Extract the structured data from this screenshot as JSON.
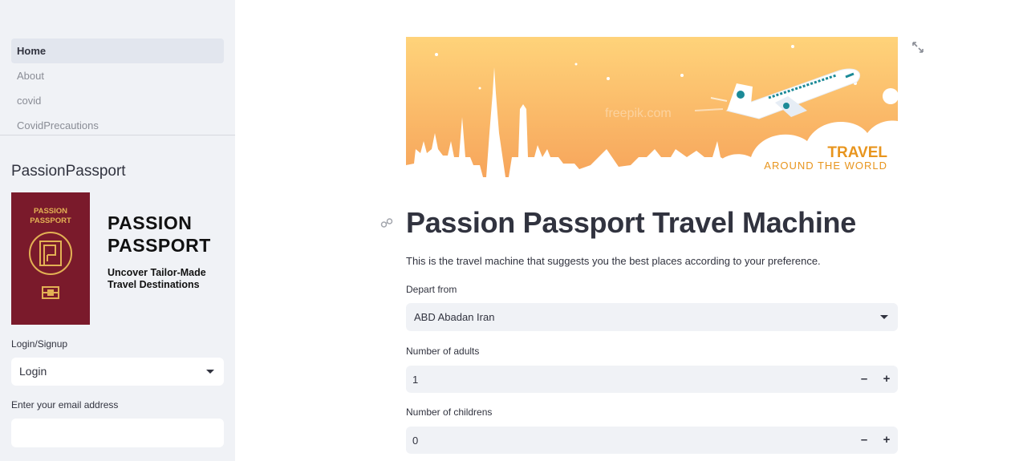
{
  "sidebar": {
    "nav": [
      {
        "label": "Home",
        "active": true
      },
      {
        "label": "About",
        "active": false
      },
      {
        "label": "covid",
        "active": false
      },
      {
        "label": "CovidPrecautions",
        "active": false
      }
    ],
    "app_title": "PassionPassport",
    "logo": {
      "cover_text": "PASSION\nPASSPORT",
      "name_line1": "PASSION",
      "name_line2": "PASSPORT",
      "tagline_line1": "Uncover Tailor-Made",
      "tagline_line2": "Travel Destinations"
    },
    "login_label": "Login/Signup",
    "login_value": "Login",
    "email_label": "Enter your email address",
    "email_value": ""
  },
  "main": {
    "banner": {
      "travel_text": "TRAVEL",
      "around_text": "AROUND THE WORLD",
      "watermark": "freepik.com"
    },
    "title": "Passion Passport Travel Machine",
    "intro": "This is the travel machine that suggests you the best places according to your preference.",
    "depart": {
      "label": "Depart from",
      "value": "ABD Abadan Iran"
    },
    "adults": {
      "label": "Number of adults",
      "value": "1"
    },
    "children": {
      "label": "Number of childrens",
      "value": "0"
    },
    "minus_symbol": "–",
    "plus_symbol": "+"
  },
  "colors": {
    "sidebar_bg": "#f0f2f6",
    "passport_red": "#7a1a2b",
    "passport_gold": "#e3b154",
    "banner_top": "#ffd37a",
    "banner_bottom": "#f6a35a",
    "travel_orange": "#e8951e"
  },
  "icons": [
    "link-icon",
    "fullscreen-icon",
    "chevron-down-icon",
    "minus-icon",
    "plus-icon",
    "airplane-icon"
  ]
}
